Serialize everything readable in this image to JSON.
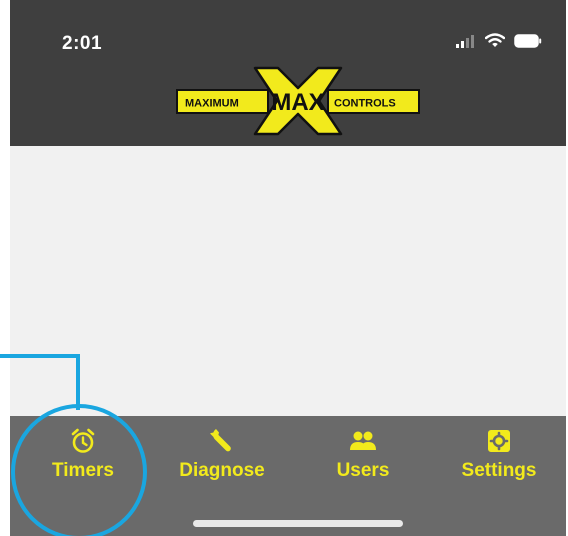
{
  "status_bar": {
    "time": "2:01",
    "icons": [
      "cellular-signal-icon",
      "wifi-icon",
      "battery-icon"
    ]
  },
  "logo": {
    "left_text": "MAXIMUM",
    "center_text": "MAX",
    "right_text": "CONTROLS"
  },
  "tabs": [
    {
      "label": "Timers",
      "icon": "alarm-clock-icon",
      "highlighted": true
    },
    {
      "label": "Diagnose",
      "icon": "wrench-icon",
      "highlighted": false
    },
    {
      "label": "Users",
      "icon": "users-icon",
      "highlighted": false
    },
    {
      "label": "Settings",
      "icon": "gear-icon",
      "highlighted": false
    }
  ],
  "colors": {
    "header_bg": "#3f3f3f",
    "tabbar_bg": "#6a6a6a",
    "accent_yellow": "#f2ea1c",
    "callout_blue": "#1aa6e0",
    "content_bg": "#f1f1f1"
  }
}
